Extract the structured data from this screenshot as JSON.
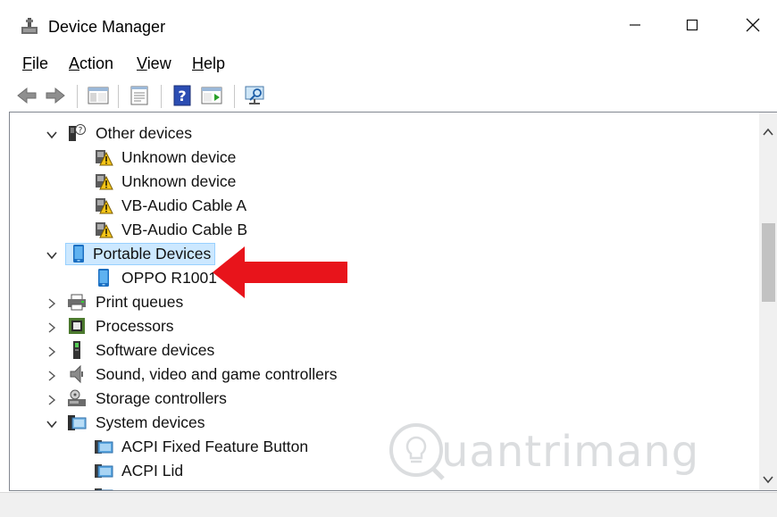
{
  "window": {
    "title": "Device Manager"
  },
  "menu": {
    "items": [
      {
        "first": "F",
        "rest": "ile"
      },
      {
        "first": "A",
        "rest": "ction"
      },
      {
        "first": "V",
        "rest": "iew"
      },
      {
        "first": "H",
        "rest": "elp"
      }
    ]
  },
  "toolbar": {
    "icons": [
      "back-icon",
      "forward-icon",
      "show-hide-console-tree-icon",
      "properties-icon",
      "help-icon",
      "action-pane-icon",
      "scan-hardware-icon"
    ]
  },
  "tree": {
    "rows": [
      {
        "label": "Other devices",
        "level": 0,
        "expander": "expanded",
        "icon": "other-devices-icon"
      },
      {
        "label": "Unknown device",
        "level": 1,
        "icon": "unknown-device-warning-icon"
      },
      {
        "label": "Unknown device",
        "level": 1,
        "icon": "unknown-device-warning-icon"
      },
      {
        "label": "VB-Audio Cable A",
        "level": 1,
        "icon": "unknown-device-warning-icon"
      },
      {
        "label": "VB-Audio Cable B",
        "level": 1,
        "icon": "unknown-device-warning-icon"
      },
      {
        "label": "Portable Devices",
        "level": 0,
        "expander": "expanded",
        "icon": "portable-device-icon",
        "selected": true
      },
      {
        "label": "OPPO R1001",
        "level": 1,
        "icon": "portable-device-icon"
      },
      {
        "label": "Print queues",
        "level": 0,
        "expander": "collapsed",
        "icon": "printer-icon"
      },
      {
        "label": "Processors",
        "level": 0,
        "expander": "collapsed",
        "icon": "processor-icon"
      },
      {
        "label": "Software devices",
        "level": 0,
        "expander": "collapsed",
        "icon": "software-device-icon"
      },
      {
        "label": "Sound, video and game controllers",
        "level": 0,
        "expander": "collapsed",
        "icon": "speaker-icon"
      },
      {
        "label": "Storage controllers",
        "level": 0,
        "expander": "collapsed",
        "icon": "storage-controller-icon"
      },
      {
        "label": "System devices",
        "level": 0,
        "expander": "expanded",
        "icon": "system-devices-icon"
      },
      {
        "label": "ACPI Fixed Feature Button",
        "level": 1,
        "icon": "system-device-icon"
      },
      {
        "label": "ACPI Lid",
        "level": 1,
        "icon": "system-device-icon"
      }
    ]
  },
  "colors": {
    "selection_bg": "#cce8ff",
    "selection_border": "#99d1ff",
    "arrow": "#e8141b"
  },
  "watermark": {
    "text": "uantrimang"
  }
}
